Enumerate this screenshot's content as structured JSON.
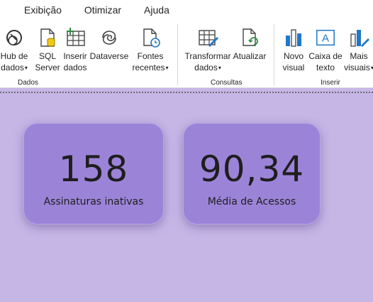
{
  "menu": [
    "Exibição",
    "Otimizar",
    "Ajuda"
  ],
  "ribbon": {
    "dados_group": "Dados",
    "consultas_group": "Consultas",
    "inserir_group": "Inserir",
    "hub": {
      "line1": "Hub de",
      "line2": "dados"
    },
    "sql": {
      "line1": "SQL",
      "line2": "Server"
    },
    "inserir_dados": {
      "line1": "Inserir",
      "line2": "dados"
    },
    "dataverse": {
      "line1": "Dataverse"
    },
    "fontes": {
      "line1": "Fontes",
      "line2": "recentes"
    },
    "transformar": {
      "line1": "Transformar",
      "line2": "dados"
    },
    "atualizar": {
      "line1": "Atualizar"
    },
    "novo_visual": {
      "line1": "Novo",
      "line2": "visual"
    },
    "caixa_texto": {
      "line1": "Caixa de",
      "line2": "texto"
    },
    "mais_visuais": {
      "line1": "Mais",
      "line2": "visuais"
    }
  },
  "icons": {
    "hub": "hub-icon",
    "sql": "database-icon",
    "inserir": "table-plus-icon",
    "dataverse": "dataverse-icon",
    "fontes": "document-clock-icon",
    "transformar": "table-pencil-icon",
    "atualizar": "refresh-document-icon",
    "novo_visual": "bar-chart-icon",
    "caixa_texto": "textbox-icon",
    "mais_visuais": "more-visuals-icon"
  },
  "colors": {
    "canvas": "#c6b6e6",
    "card": "#9b84d8",
    "accent_blue": "#1f78c8"
  },
  "cards": [
    {
      "value": "158",
      "label": "Assinaturas inativas"
    },
    {
      "value": "90,34",
      "label": "Média de Acessos"
    }
  ]
}
